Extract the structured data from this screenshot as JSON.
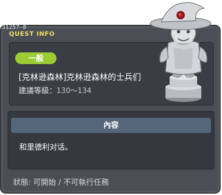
{
  "quest": {
    "id": "31257-0",
    "panel_title": "QUEST INFO",
    "category": "一般",
    "title": "[克林逊森林]克林逊森林的士兵们",
    "level_label": "建議等級：",
    "level_value": "130～134",
    "content_header": "內容",
    "content_text": "和里德利对话。",
    "status": "狀態:  可開始 / 不可執行任務"
  },
  "colors": {
    "badge": "#9bcc34",
    "title_accent": "#f2e06a",
    "content_header_bg": "#55667a",
    "window_bg": "#4a4e55"
  },
  "icons": {
    "statue": "wizard-statue-icon"
  }
}
